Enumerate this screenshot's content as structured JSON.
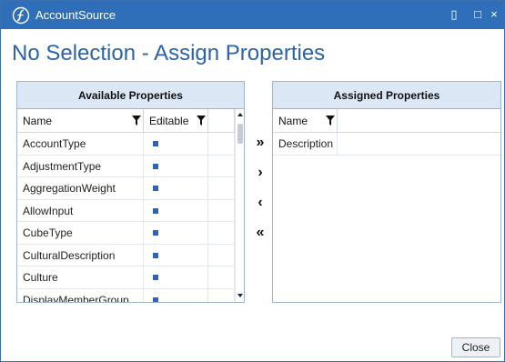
{
  "window": {
    "title": "AccountSource",
    "controls": {
      "restore": "▯",
      "maximize": "□",
      "close": "×"
    }
  },
  "page_title": "No Selection - Assign Properties",
  "available": {
    "header": "Available Properties",
    "columns": {
      "name": "Name",
      "editable": "Editable"
    },
    "rows": [
      {
        "name": "AccountType",
        "editable": true
      },
      {
        "name": "AdjustmentType",
        "editable": true
      },
      {
        "name": "AggregationWeight",
        "editable": true
      },
      {
        "name": "AllowInput",
        "editable": true
      },
      {
        "name": "CubeType",
        "editable": true
      },
      {
        "name": "CulturalDescription",
        "editable": true
      },
      {
        "name": "Culture",
        "editable": true
      },
      {
        "name": "DisplayMemberGroup",
        "editable": true
      }
    ]
  },
  "assigned": {
    "header": "Assigned Properties",
    "columns": {
      "name": "Name"
    },
    "rows": [
      {
        "name": "Description"
      }
    ]
  },
  "move_buttons": {
    "add_all": "»",
    "add": "›",
    "remove": "‹",
    "remove_all": "«"
  },
  "footer": {
    "close_label": "Close"
  }
}
